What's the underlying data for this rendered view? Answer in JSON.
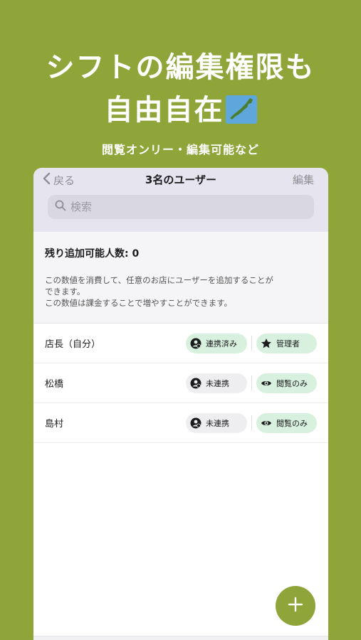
{
  "promo": {
    "headline_line1": "シフトの編集権限も",
    "headline_line2": "自由自在",
    "subtitle": "閲覧オンリー・編集可能など"
  },
  "nav": {
    "back_label": "戻る",
    "title": "3名のユーザー",
    "edit_label": "編集"
  },
  "search": {
    "placeholder": "検索"
  },
  "info": {
    "remaining": "残り追加可能人数: 0",
    "desc_line1": "この数値を消費して、任意のお店にユーザーを追加することが",
    "desc_line2": "できます。",
    "desc_line3": "この数値は課金することで増やすことができます。"
  },
  "users": [
    {
      "name": "店長（自分）",
      "link_status": "連携済み",
      "role": "管理者",
      "linked": true,
      "role_icon": "star-icon"
    },
    {
      "name": "松橋",
      "link_status": "未連携",
      "role": "閲覧のみ",
      "linked": false,
      "role_icon": "eye-icon"
    },
    {
      "name": "島村",
      "link_status": "未連携",
      "role": "閲覧のみ",
      "linked": false,
      "role_icon": "eye-icon"
    }
  ],
  "colors": {
    "brand_green": "#8fa53a",
    "badge_green": "#d8f1de",
    "badge_gray": "#eeeef1"
  },
  "icons": {
    "back": "chevron-left-icon",
    "search": "search-icon",
    "link_badge": "person-link-icon",
    "fab": "plus-icon"
  }
}
